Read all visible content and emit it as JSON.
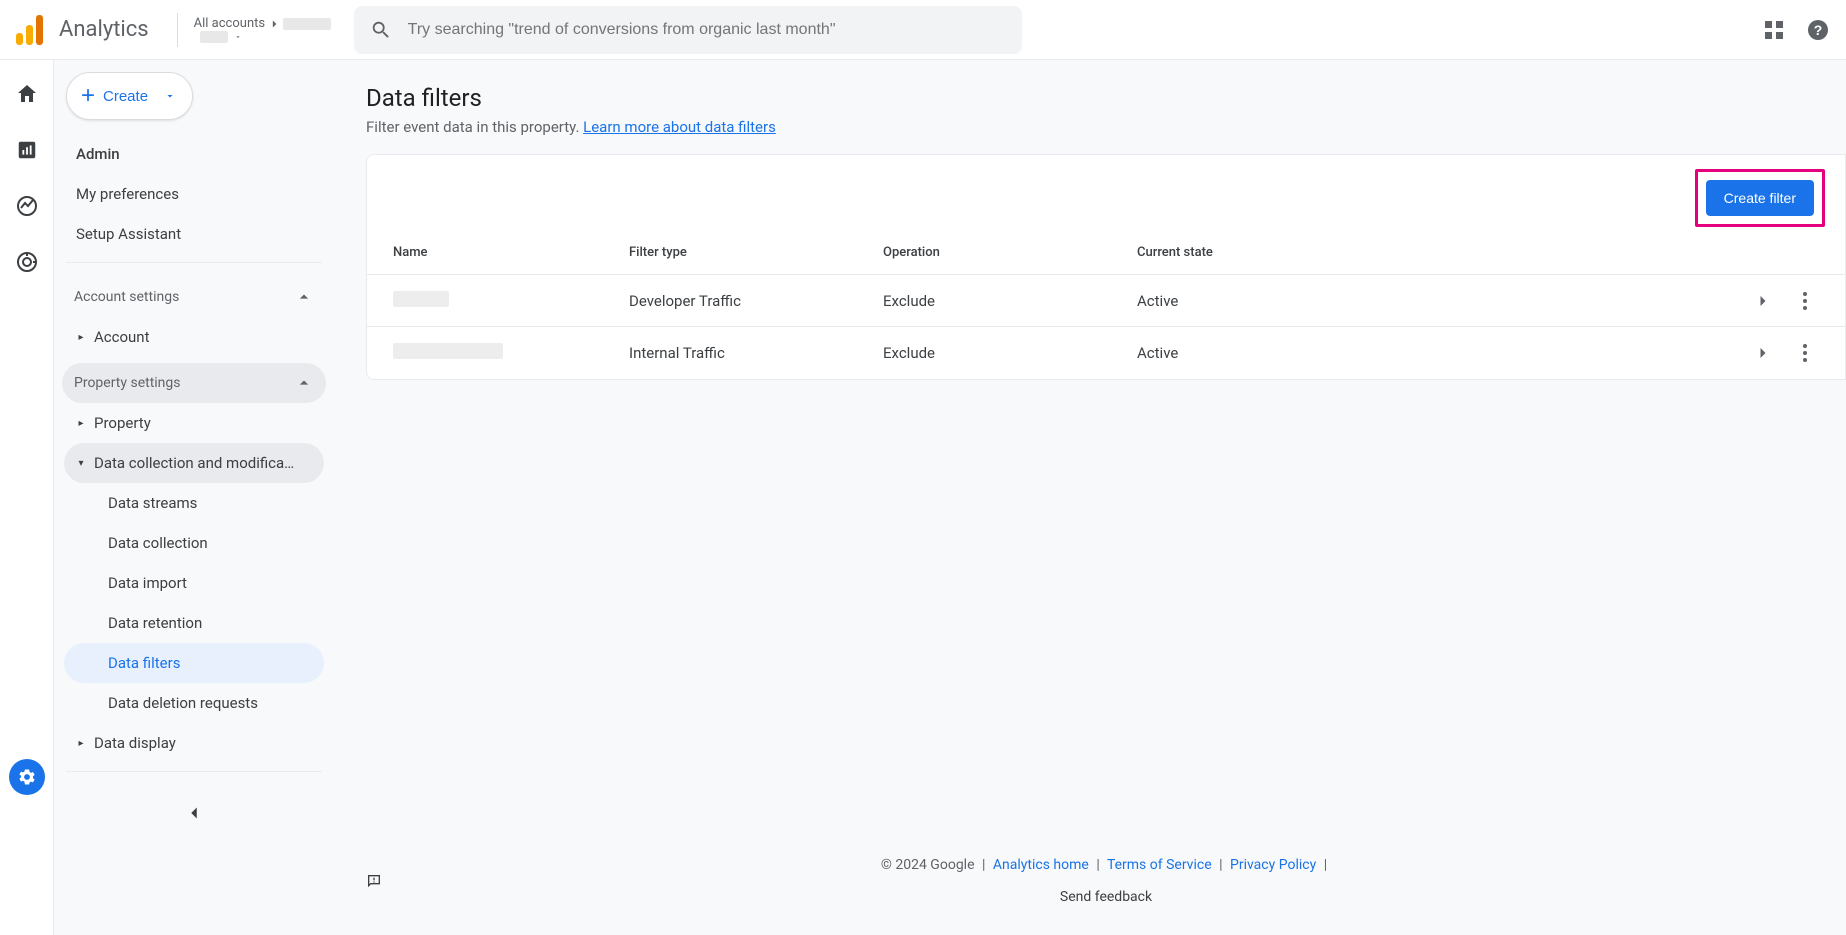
{
  "header": {
    "brand": "Analytics",
    "account_line1_prefix": "All accounts",
    "account_line2_prefix": "",
    "search_placeholder": "Try searching \"trend of conversions from organic last month\""
  },
  "sidenav": {
    "create_label": "Create",
    "items_top": [
      {
        "label": "Admin"
      },
      {
        "label": "My preferences"
      },
      {
        "label": "Setup Assistant"
      }
    ],
    "section_account": "Account settings",
    "account_item": "Account",
    "section_property": "Property settings",
    "property_item": "Property",
    "data_collection_group": "Data collection and modifica…",
    "data_children": [
      "Data streams",
      "Data collection",
      "Data import",
      "Data retention",
      "Data filters",
      "Data deletion requests"
    ],
    "data_display_item": "Data display"
  },
  "main": {
    "title": "Data filters",
    "subtitle": "Filter event data in this property.",
    "learn_more": "Learn more about data filters",
    "create_filter_btn": "Create filter",
    "columns": {
      "name": "Name",
      "type": "Filter type",
      "operation": "Operation",
      "state": "Current state"
    },
    "rows": [
      {
        "name": "",
        "type": "Developer Traffic",
        "operation": "Exclude",
        "state": "Active"
      },
      {
        "name": "",
        "type": "Internal Traffic",
        "operation": "Exclude",
        "state": "Active"
      }
    ]
  },
  "footer": {
    "copyright": "© 2024 Google",
    "links": {
      "home": "Analytics home",
      "terms": "Terms of Service",
      "privacy": "Privacy Policy"
    },
    "feedback": "Send feedback"
  }
}
